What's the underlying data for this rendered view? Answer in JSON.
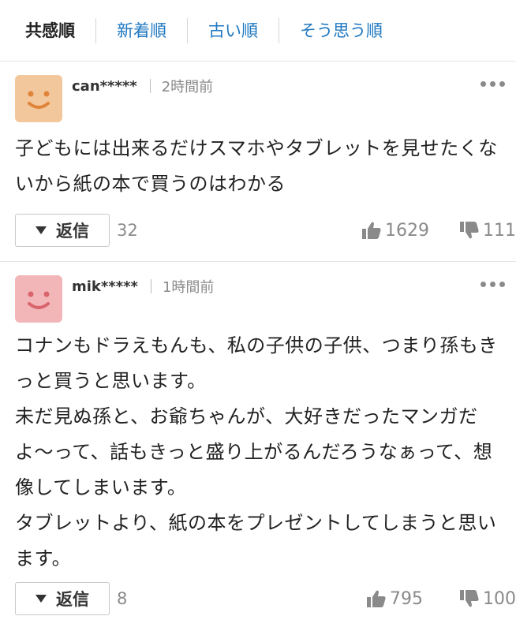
{
  "sort_tabs": [
    {
      "label": "共感順",
      "active": true
    },
    {
      "label": "新着順",
      "active": false
    },
    {
      "label": "古い順",
      "active": false
    },
    {
      "label": "そう思う順",
      "active": false
    }
  ],
  "comments": [
    {
      "avatar_color": "#f2c79c",
      "avatar_face_color": "#e0843a",
      "username": "can*****",
      "time": "2時間前",
      "body": "子どもには出来るだけスマホやタブレットを見せたくないから紙の本で買うのはわかる",
      "reply_label": "返信",
      "reply_count": "32",
      "likes": "1629",
      "dislikes": "111"
    },
    {
      "avatar_color": "#f2b6b9",
      "avatar_face_color": "#d9646b",
      "username": "mik*****",
      "time": "1時間前",
      "body": "コナンもドラえもんも、私の子供の子供、つまり孫もきっと買うと思います。\n未だ見ぬ孫と、お爺ちゃんが、大好きだったマンガだよ〜って、話もきっと盛り上がるんだろうなぁって、想像してしまいます。\nタブレットより、紙の本をプレゼントしてしまうと思います。",
      "reply_label": "返信",
      "reply_count": "8",
      "likes": "795",
      "dislikes": "100"
    }
  ]
}
